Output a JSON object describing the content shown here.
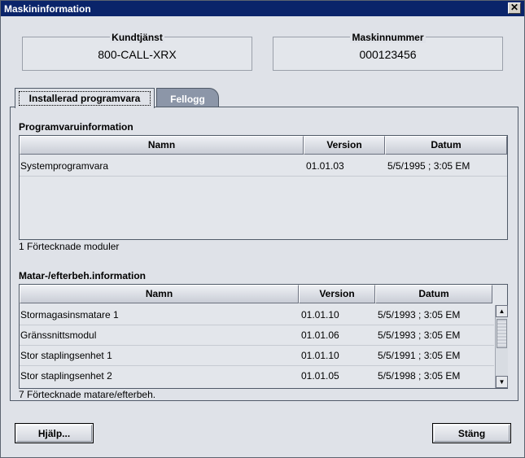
{
  "window": {
    "title": "Maskininformation",
    "close_glyph": "✕"
  },
  "customer_service": {
    "label": "Kundtjänst",
    "value": "800-CALL-XRX"
  },
  "machine_number": {
    "label": "Maskinnummer",
    "value": "000123456"
  },
  "tabs": [
    {
      "label": "Installerad programvara",
      "active": true
    },
    {
      "label": "Fellogg",
      "active": false
    }
  ],
  "software": {
    "title": "Programvaruinformation",
    "columns": [
      "Namn",
      "Version",
      "Datum"
    ],
    "rows": [
      {
        "name": "Systemprogramvara",
        "version": "01.01.03",
        "date": "5/5/1995 ; 3:05 EM"
      }
    ],
    "count_text": "1 Förtecknade moduler"
  },
  "feeder": {
    "title": "Matar-/efterbeh.information",
    "columns": [
      "Namn",
      "Version",
      "Datum"
    ],
    "rows": [
      {
        "name": "Stormagasinsmatare 1",
        "version": "01.01.10",
        "date": "5/5/1993 ; 3:05 EM"
      },
      {
        "name": "Gränssnittsmodul",
        "version": "01.01.06",
        "date": "5/5/1993 ; 3:05 EM"
      },
      {
        "name": "Stor staplingsenhet 1",
        "version": "01.01.10",
        "date": "5/5/1991 ; 3:05 EM"
      },
      {
        "name": "Stor staplingsenhet 2",
        "version": "01.01.05",
        "date": "5/5/1998 ; 3:05 EM"
      }
    ],
    "count_text": "7 Förtecknade matare/efterbeh."
  },
  "buttons": {
    "help": "Hjälp...",
    "close": "Stäng"
  },
  "icons": {
    "scroll_up": "▲",
    "scroll_down": "▼"
  }
}
